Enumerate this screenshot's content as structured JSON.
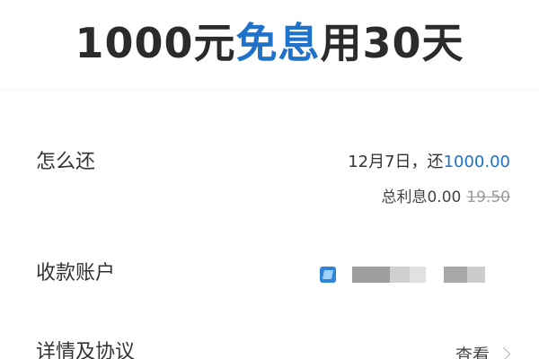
{
  "headline": {
    "prefix": "1000元",
    "accent": "免息",
    "suffix": "用30天",
    "accent_color": "#1e72c9"
  },
  "repayment": {
    "label": "怎么还",
    "date_text": "12月7日，还",
    "amount": "1000.00",
    "interest_label": "总利息0.00",
    "original_interest": "19.50"
  },
  "account": {
    "label": "收款账户",
    "bank_icon": "bank-card-icon"
  },
  "details": {
    "label": "详情及协议",
    "action": "查看",
    "action_icon": "chevron-right-icon"
  }
}
